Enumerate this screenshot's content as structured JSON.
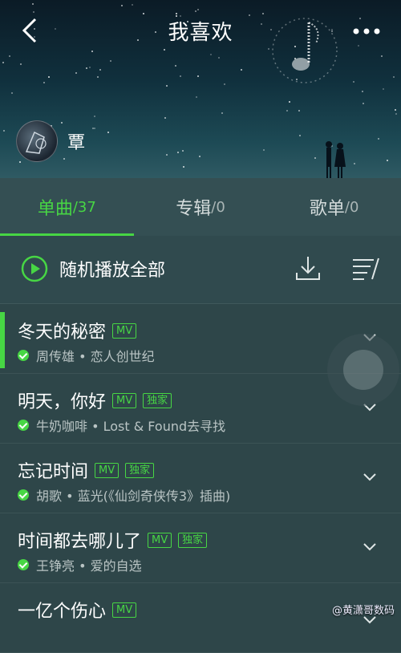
{
  "header": {
    "title": "我喜欢",
    "owner_name": "覃"
  },
  "tabs": [
    {
      "label": "单曲",
      "count": "/37",
      "active": true
    },
    {
      "label": "专辑",
      "count": "/0",
      "active": false
    },
    {
      "label": "歌单",
      "count": "/0",
      "active": false
    }
  ],
  "actions": {
    "play_all_label": "随机播放全部"
  },
  "songs": [
    {
      "title": "冬天的秘密",
      "badges": [
        "MV"
      ],
      "sub": "周传雄 • 恋人创世纪"
    },
    {
      "title": "明天，你好",
      "badges": [
        "MV",
        "独家"
      ],
      "sub": "牛奶咖啡 • Lost & Found去寻找"
    },
    {
      "title": "忘记时间",
      "badges": [
        "MV",
        "独家"
      ],
      "sub": "胡歌 • 蓝光(《仙剑奇侠传3》插曲)"
    },
    {
      "title": "时间都去哪儿了",
      "badges": [
        "MV",
        "独家"
      ],
      "sub": "王铮亮 • 爱的自选"
    },
    {
      "title": "一亿个伤心",
      "badges": [
        "MV"
      ],
      "sub": ""
    }
  ],
  "watermark": "@黄潇哥数码",
  "colors": {
    "accent": "#47d644",
    "background": "#2e4649"
  }
}
